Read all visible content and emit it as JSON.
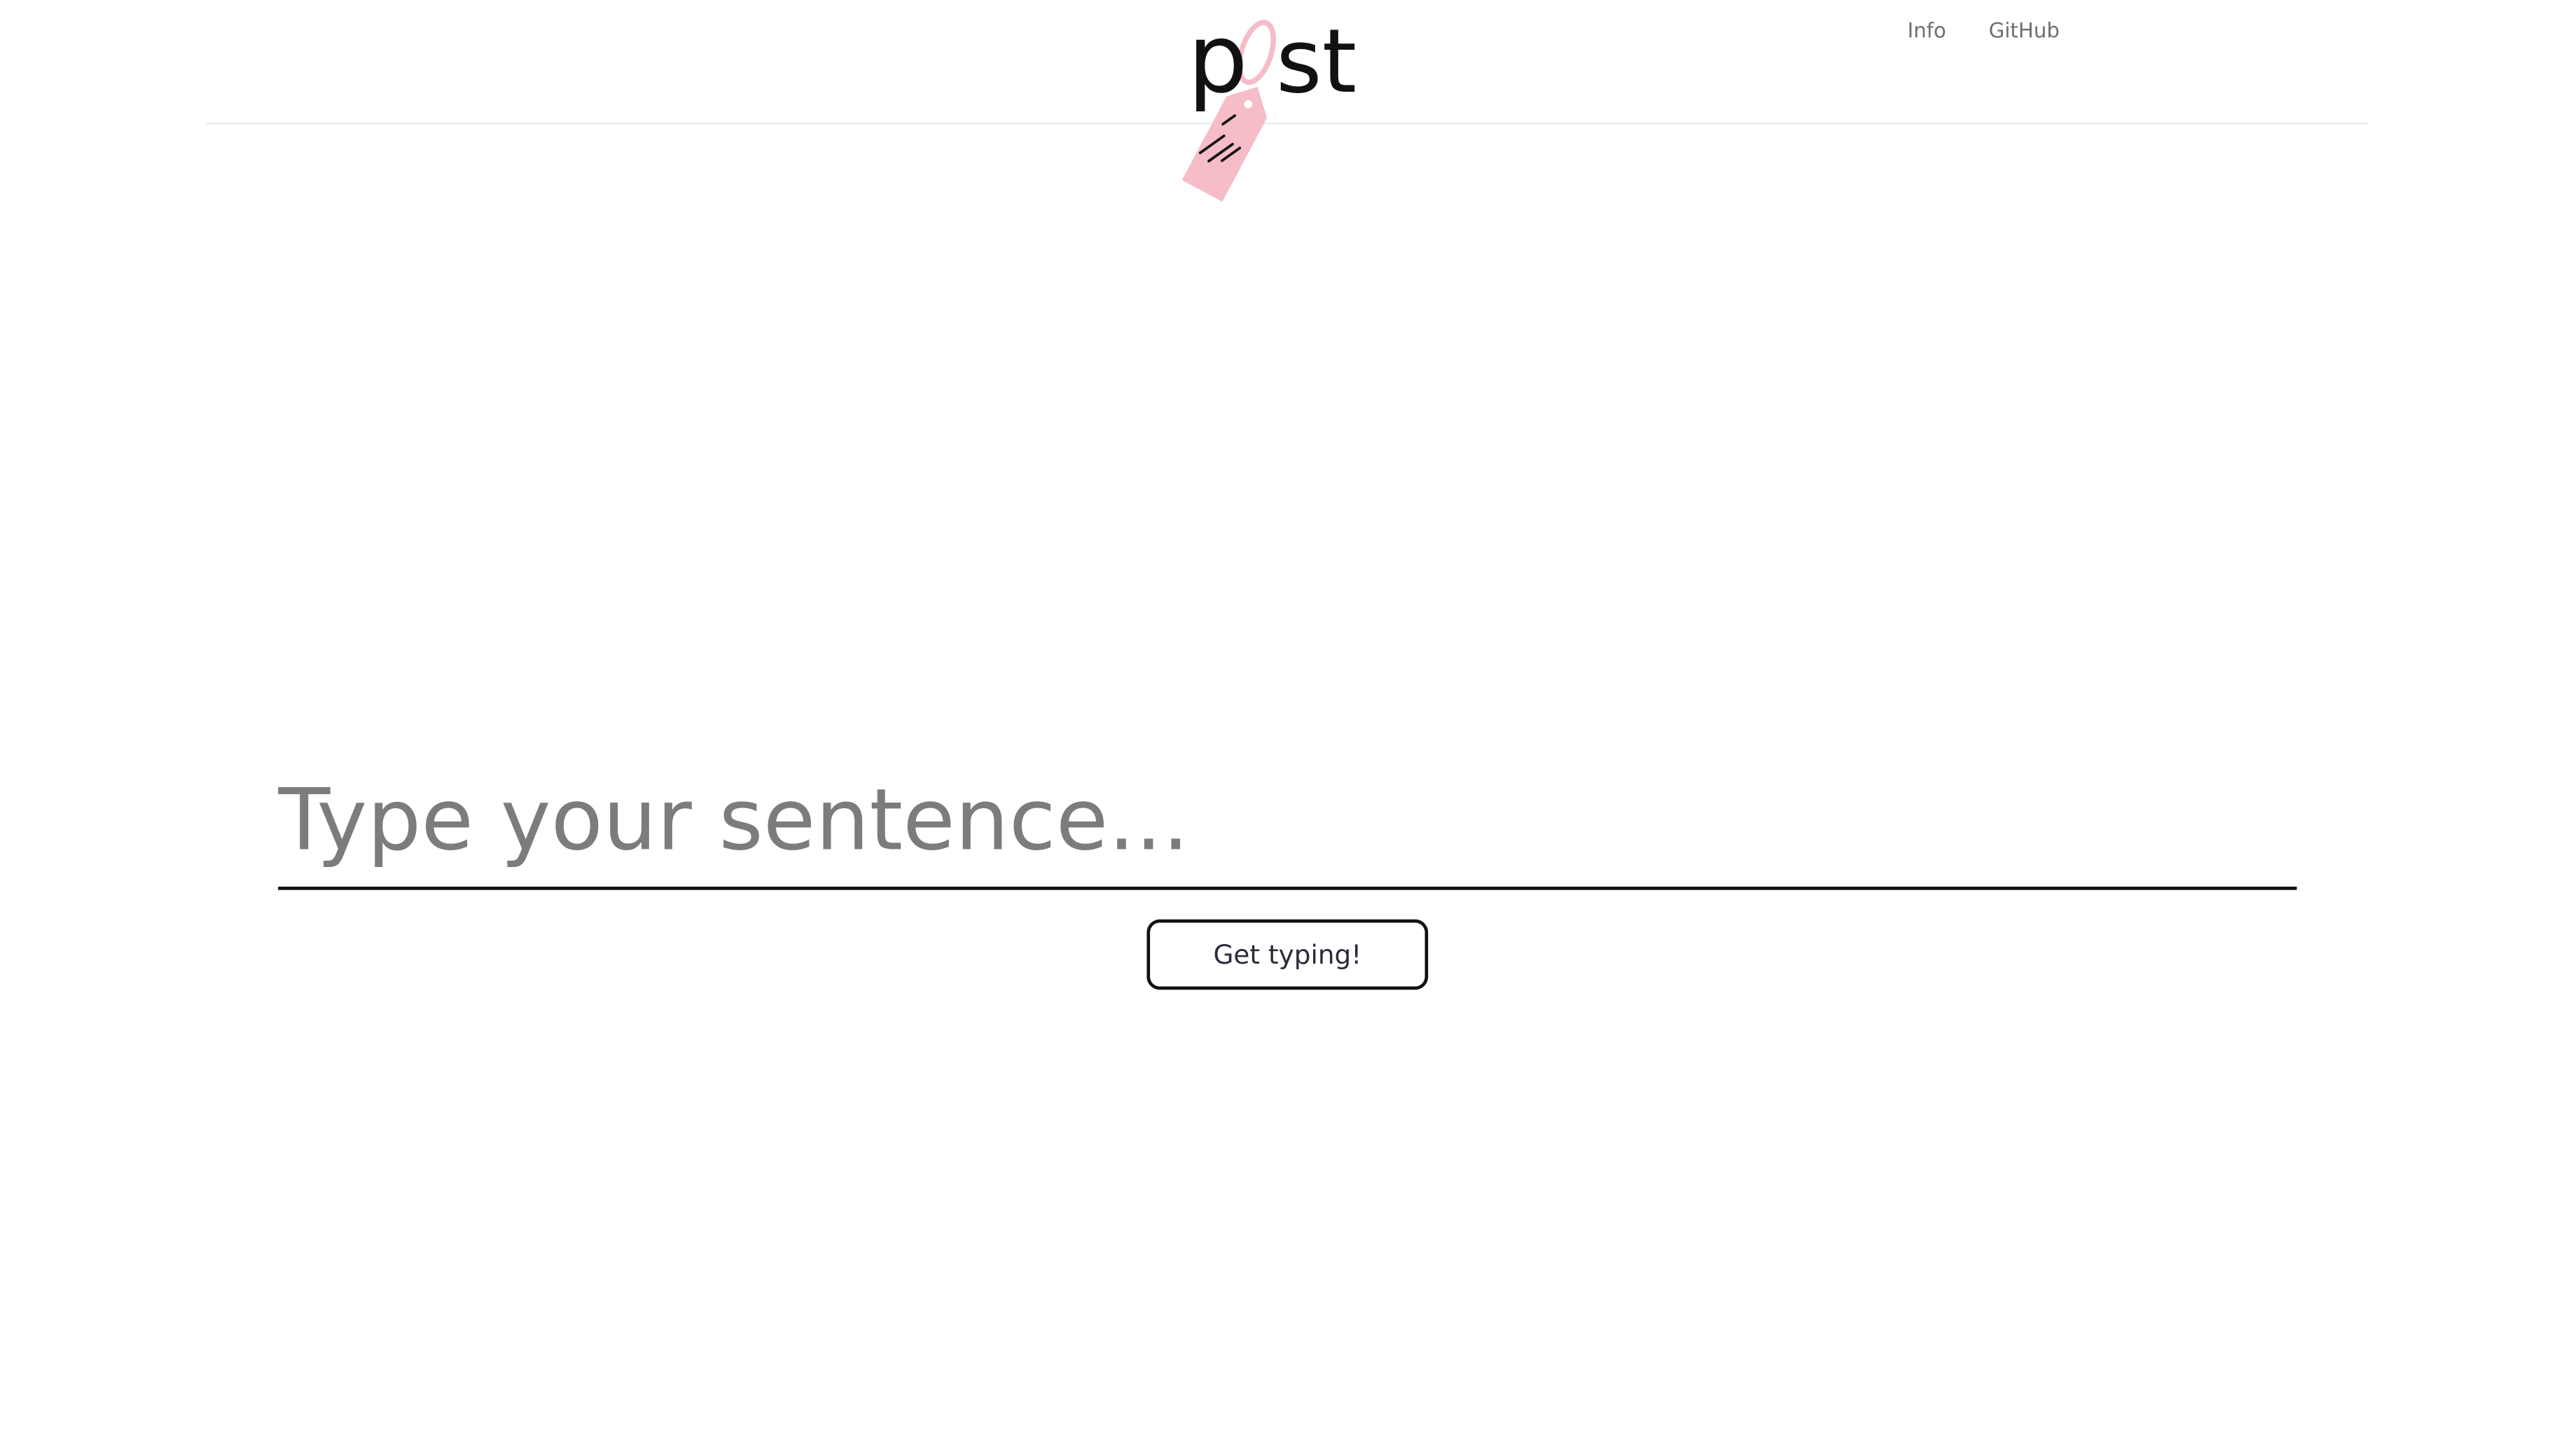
{
  "header": {
    "logo": {
      "letter_p": "p",
      "letter_o": "o",
      "letters_st": "st",
      "tag_color": "#f6bcc7",
      "icon": "price-tag-icon"
    },
    "nav": [
      {
        "label": "Info"
      },
      {
        "label": "GitHub"
      }
    ]
  },
  "main": {
    "sentence_input": {
      "value": "",
      "placeholder": "Type your sentence..."
    },
    "cta_label": "Get typing!"
  },
  "colors": {
    "background": "#ffffff",
    "text_dark": "#111111",
    "placeholder": "#7c7c7c",
    "nav_text": "#6f6f6f",
    "accent_pink": "#f6bcc7"
  }
}
